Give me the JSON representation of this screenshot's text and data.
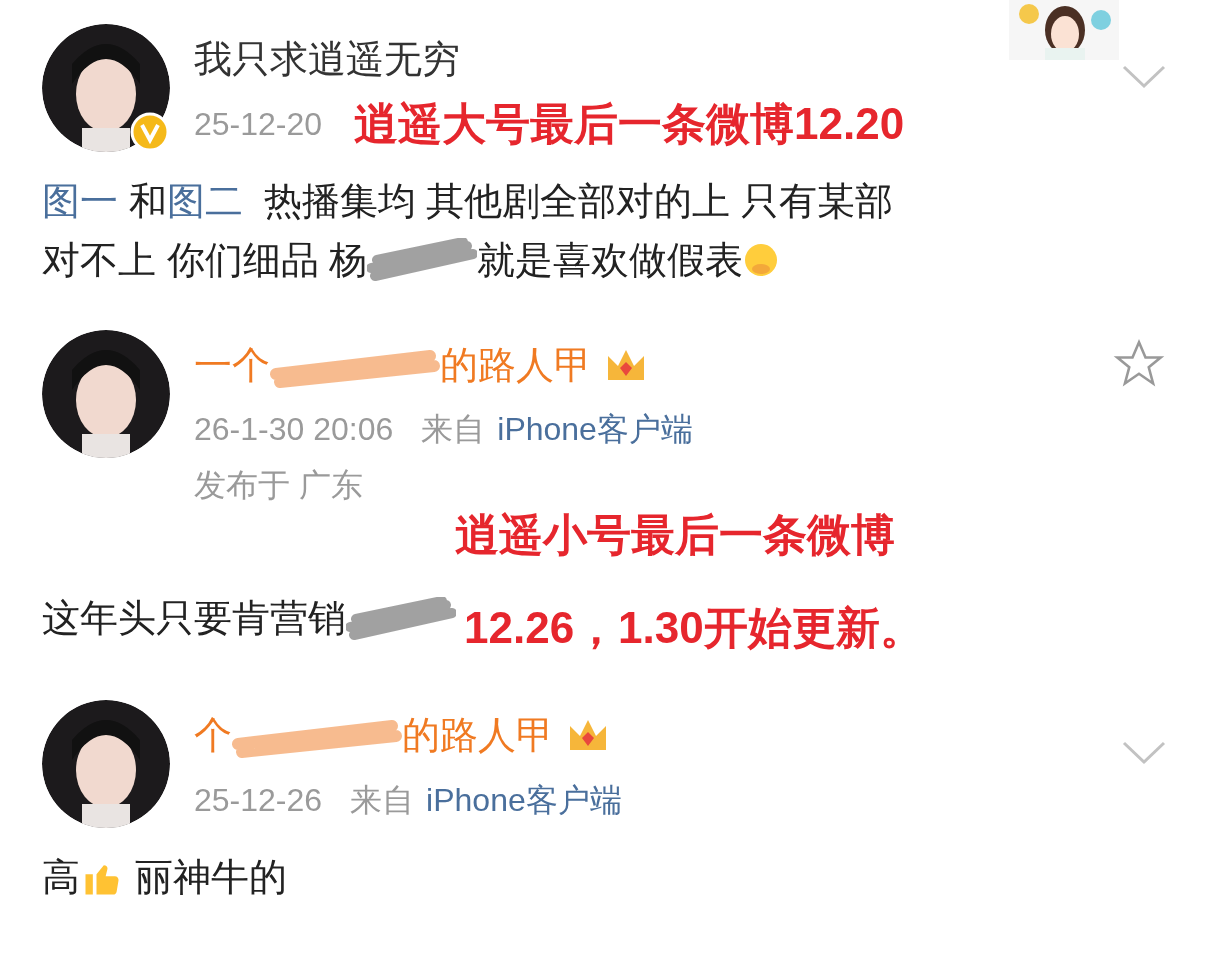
{
  "posts": [
    {
      "kind": "verified",
      "name_parts": [
        "我只求逍遥无穷"
      ],
      "meta": [
        {
          "kind": "time",
          "text": "25-12-20"
        }
      ],
      "annotation": [
        "逍遥大号最后一条微博12.20"
      ],
      "body": [
        [
          {
            "kind": "link",
            "text": "图一"
          },
          {
            "kind": "text",
            "text": " 和"
          },
          {
            "kind": "link",
            "text": "图二"
          },
          {
            "kind": "text",
            "text": "  热播集均 其他剧全部对的上 只有某部"
          }
        ],
        [
          {
            "kind": "text",
            "text": "对不上 你们细品 杨"
          },
          {
            "kind": "scribble"
          },
          {
            "kind": "text",
            "text": "就是喜欢做假表"
          },
          {
            "kind": "emoji"
          }
        ]
      ]
    },
    {
      "kind": "member_star",
      "name_parts": [
        "一个",
        "的路人甲"
      ],
      "meta": [
        {
          "kind": "time",
          "text": "26-1-30 20:06"
        },
        {
          "kind": "from",
          "text": "来自"
        },
        {
          "kind": "source",
          "text": "iPhone客户端"
        }
      ],
      "location": "发布于 广东",
      "annotation": [
        "逍遥小号最后一条微博",
        "12.26，1.30开始更新。"
      ],
      "body": [
        [
          {
            "kind": "text",
            "text": "这年头只要肯营销"
          },
          {
            "kind": "scribble"
          }
        ]
      ]
    },
    {
      "kind": "member_menu",
      "name_parts": [
        "个",
        "的路人甲"
      ],
      "meta": [
        {
          "kind": "time",
          "text": "25-12-26"
        },
        {
          "kind": "from",
          "text": "来自"
        },
        {
          "kind": "source",
          "text": "iPhone客户端"
        }
      ],
      "body": [
        [
          {
            "kind": "text",
            "text": "高"
          },
          {
            "kind": "thumb"
          },
          {
            "kind": "text",
            "text": " 丽神牛的"
          }
        ]
      ]
    }
  ]
}
